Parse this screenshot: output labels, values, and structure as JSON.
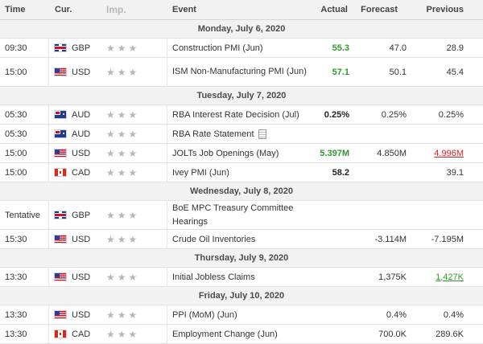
{
  "header": {
    "time": "Time",
    "cur": "Cur.",
    "imp": "Imp.",
    "event": "Event",
    "actual": "Actual",
    "forecast": "Forecast",
    "previous": "Previous"
  },
  "star_glyph": "★",
  "flag_icons": {
    "GBP": "uk-flag-icon",
    "USD": "us-flag-icon",
    "AUD": "australia-flag-icon",
    "CAD": "canada-flag-icon"
  },
  "colors": {
    "positive": "#2e9a2e",
    "negative": "#d22222",
    "day_bg": "#f2f2f2",
    "star": "#b7b7b7"
  },
  "days": [
    {
      "label": "Monday, July 6, 2020",
      "events": [
        {
          "time": "09:30",
          "cur": "GBP",
          "event": "Construction PMI (Jun)",
          "actual": "55.3",
          "actual_style": "green",
          "forecast": "47.0",
          "previous": "28.9",
          "previous_style": ""
        },
        {
          "time": "15:00",
          "cur": "USD",
          "event": "ISM Non-Manufacturing PMI (Jun)",
          "actual": "57.1",
          "actual_style": "green",
          "forecast": "50.1",
          "previous": "45.4",
          "previous_style": "",
          "tall": true
        }
      ]
    },
    {
      "label": "Tuesday, July 7, 2020",
      "events": [
        {
          "time": "05:30",
          "cur": "AUD",
          "event": "RBA Interest Rate Decision (Jul)",
          "actual": "0.25%",
          "actual_style": "bold",
          "forecast": "0.25%",
          "previous": "0.25%",
          "previous_style": ""
        },
        {
          "time": "05:30",
          "cur": "AUD",
          "event": "RBA Rate Statement",
          "actual": "",
          "actual_style": "",
          "forecast": "",
          "previous": "",
          "previous_style": "",
          "doc": true
        },
        {
          "time": "15:00",
          "cur": "USD",
          "event": "JOLTs Job Openings (May)",
          "actual": "5.397M",
          "actual_style": "green",
          "forecast": "4.850M",
          "previous": "4.996M",
          "previous_style": "red"
        },
        {
          "time": "15:00",
          "cur": "CAD",
          "event": "Ivey PMI (Jun)",
          "actual": "58.2",
          "actual_style": "bold",
          "forecast": "",
          "previous": "39.1",
          "previous_style": ""
        }
      ]
    },
    {
      "label": "Wednesday, July 8, 2020",
      "events": [
        {
          "time": "Tentative",
          "cur": "GBP",
          "event": "BoE MPC Treasury Committee Hearings",
          "actual": "",
          "actual_style": "",
          "forecast": "",
          "previous": "",
          "previous_style": "",
          "tall": true
        },
        {
          "time": "15:30",
          "cur": "USD",
          "event": "Crude Oil Inventories",
          "actual": "",
          "actual_style": "",
          "forecast": "-3.114M",
          "previous": "-7.195M",
          "previous_style": ""
        }
      ]
    },
    {
      "label": "Thursday, July 9, 2020",
      "events": [
        {
          "time": "13:30",
          "cur": "USD",
          "event": "Initial Jobless Claims",
          "actual": "",
          "actual_style": "",
          "forecast": "1,375K",
          "previous": "1,427K",
          "previous_style": "greenu"
        }
      ]
    },
    {
      "label": "Friday, July 10, 2020",
      "events": [
        {
          "time": "13:30",
          "cur": "USD",
          "event": "PPI (MoM) (Jun)",
          "actual": "",
          "actual_style": "",
          "forecast": "0.4%",
          "previous": "0.4%",
          "previous_style": ""
        },
        {
          "time": "13:30",
          "cur": "CAD",
          "event": "Employment Change (Jun)",
          "actual": "",
          "actual_style": "",
          "forecast": "700.0K",
          "previous": "289.6K",
          "previous_style": ""
        }
      ]
    }
  ]
}
